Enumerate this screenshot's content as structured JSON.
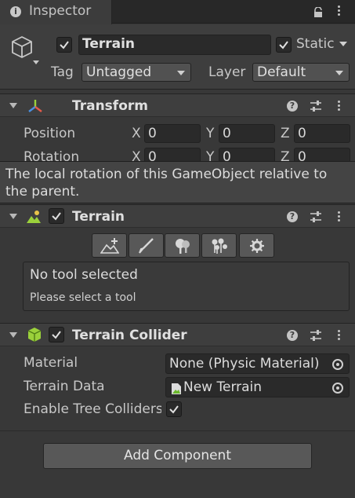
{
  "tab": {
    "title": "Inspector"
  },
  "header": {
    "name": "Terrain",
    "static_label": "Static",
    "tag_label": "Tag",
    "tag_value": "Untagged",
    "layer_label": "Layer",
    "layer_value": "Default",
    "active": true,
    "static": true
  },
  "transform": {
    "title": "Transform",
    "rows": [
      {
        "label": "Position",
        "x": "0",
        "y": "0",
        "z": "0"
      },
      {
        "label": "Rotation",
        "x": "0",
        "y": "0",
        "z": "0"
      }
    ],
    "axis": {
      "x": "X",
      "y": "Y",
      "z": "Z"
    }
  },
  "tooltip": {
    "text": "The local rotation of this GameObject relative to the parent."
  },
  "terrain": {
    "title": "Terrain",
    "tools": [
      "raise-terrain-icon",
      "paint-brush-icon",
      "trees-icon",
      "details-icon",
      "settings-icon"
    ],
    "status_title": "No tool selected",
    "status_hint": "Please select a tool"
  },
  "collider": {
    "title": "Terrain Collider",
    "material_label": "Material",
    "material_value": "None (Physic Material)",
    "data_label": "Terrain Data",
    "data_value": "New Terrain",
    "trees_label": "Enable Tree Colliders",
    "trees_checked": true
  },
  "add_component": "Add Component",
  "colors": {
    "background": "#383838",
    "header": "#3e3e3e",
    "accent_green": "#9bd13b"
  }
}
